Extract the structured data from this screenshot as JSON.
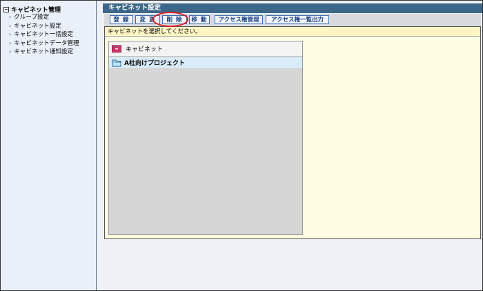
{
  "sidebar": {
    "root_label": "キャビネット管理",
    "items": [
      {
        "label": "グループ設定"
      },
      {
        "label": "キャビネット設定"
      },
      {
        "label": "キャビネット一括設定"
      },
      {
        "label": "キャビネットデータ管理"
      },
      {
        "label": "キャビネット通知設定"
      }
    ]
  },
  "main": {
    "title": "キャビネット設定",
    "toolbar": {
      "register": "登 録",
      "change": "変 更",
      "delete": "削 除",
      "move": "移 動",
      "access_manage": "アクセス権管理",
      "access_list_output": "アクセス権一覧出力"
    },
    "message": "キャビネットを選択してください。",
    "tree": {
      "root_label": "キャビネット",
      "items": [
        {
          "label": "A社向けプロジェクト"
        }
      ]
    }
  },
  "colors": {
    "titlebar": "#3d6788",
    "highlight_ring": "#e21d1d",
    "selected_row": "#d8ecf9"
  }
}
